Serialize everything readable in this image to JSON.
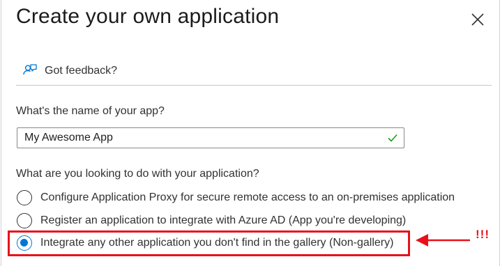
{
  "dialog": {
    "title": "Create your own application",
    "close_icon": "close-icon"
  },
  "feedback": {
    "icon": "feedback-icon",
    "label": "Got feedback?"
  },
  "name_question": {
    "label": "What's the name of your app?",
    "value": "My Awesome App",
    "valid_icon": "checkmark-icon",
    "valid_color": "#13a10e"
  },
  "purpose_question": {
    "label": "What are you looking to do with your application?",
    "options": [
      {
        "label": "Configure Application Proxy for secure remote access to an on-premises application",
        "selected": false
      },
      {
        "label": "Register an application to integrate with Azure AD (App you're developing)",
        "selected": false
      },
      {
        "label": "Integrate any other application you don't find in the gallery (Non-gallery)",
        "selected": true
      }
    ]
  },
  "annotation": {
    "text": "!!!",
    "color": "#e8111b",
    "arrow_icon": "arrow-left-icon"
  },
  "colors": {
    "accent": "#0078d4",
    "text": "#323130"
  }
}
